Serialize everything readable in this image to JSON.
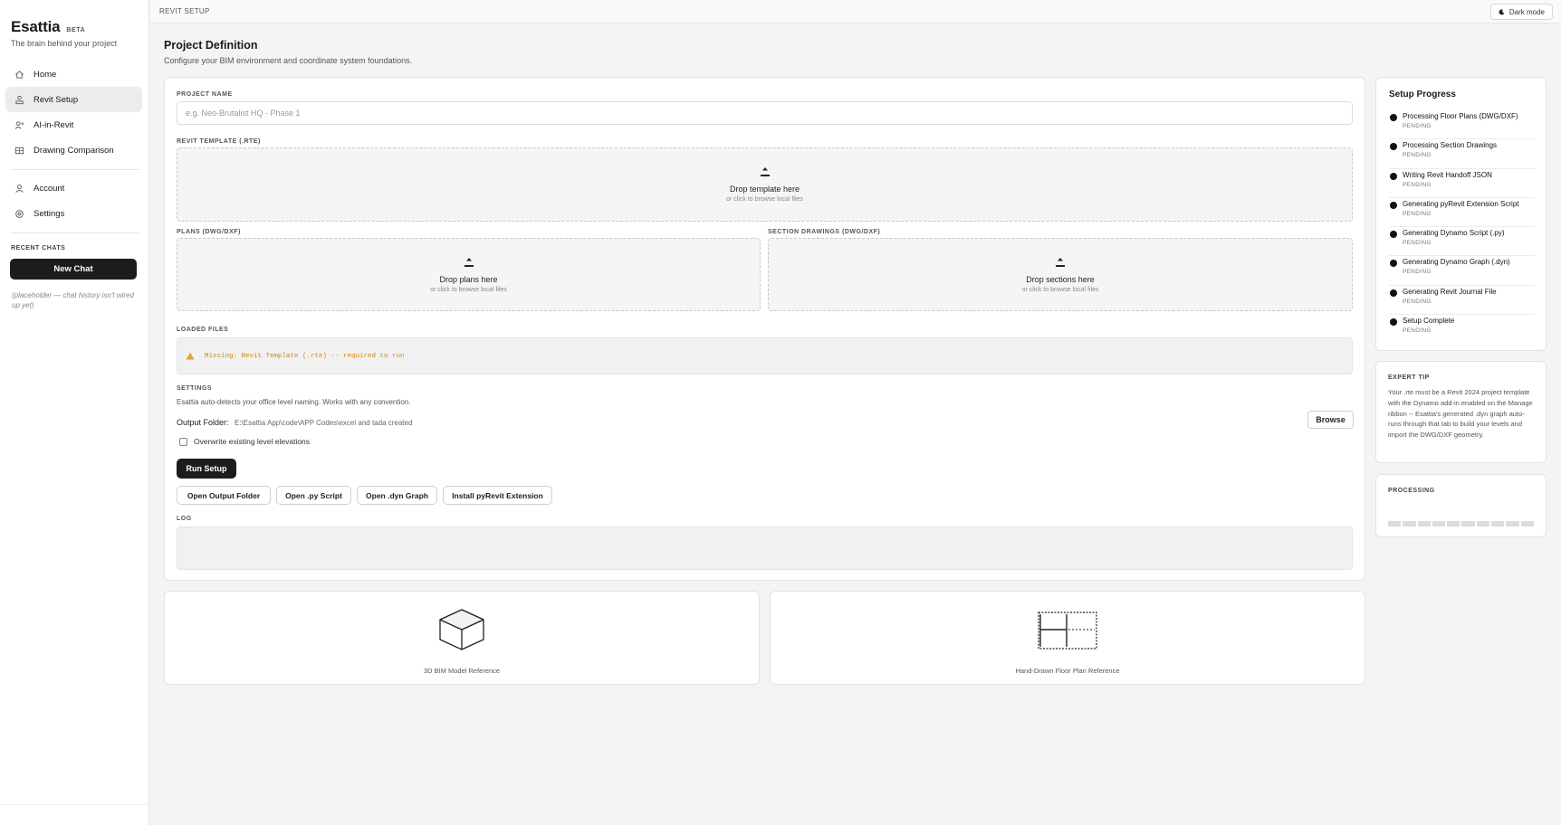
{
  "app": {
    "name": "Esattia",
    "badge": "BETA",
    "tagline": "The brain behind your project"
  },
  "nav": {
    "items": [
      {
        "label": "Home",
        "icon": "home-icon"
      },
      {
        "label": "Revit Setup",
        "icon": "revit-setup-icon",
        "active": true
      },
      {
        "label": "AI-in-Revit",
        "icon": "ai-icon"
      },
      {
        "label": "Drawing Comparison",
        "icon": "comparison-icon"
      }
    ],
    "secondary": [
      {
        "label": "Account",
        "icon": "user-icon"
      },
      {
        "label": "Settings",
        "icon": "gear-icon"
      }
    ]
  },
  "recent": {
    "title": "RECENT CHATS",
    "new_chat": "New Chat",
    "placeholder": "(placeholder — chat history isn't wired up yet)"
  },
  "topbar": {
    "breadcrumb": "REVIT SETUP",
    "dark_mode": "Dark mode"
  },
  "header": {
    "title": "Project Definition",
    "subtitle": "Configure your BIM environment and coordinate system foundations."
  },
  "form": {
    "project_name_label": "PROJECT NAME",
    "project_name_placeholder": "e.g. Neo-Brutalist HQ - Phase 1",
    "project_name_value": "",
    "template_label": "REVIT TEMPLATE (.RTE)",
    "template_drop_title": "Drop template here",
    "template_drop_sub": "or click to browse local files",
    "plans_label": "PLANS (DWG/DXF)",
    "plans_drop_title": "Drop plans here",
    "plans_drop_sub": "or click to browse local files",
    "sections_label": "SECTION DRAWINGS (DWG/DXF)",
    "sections_drop_title": "Drop sections here",
    "sections_drop_sub": "or click to browse local files",
    "loaded_label": "LOADED FILES",
    "loaded_warning": "Missing: Revit Template (.rte) -- required to run",
    "settings_label": "SETTINGS",
    "settings_desc": "Esattia auto-detects your office level naming. Works with any convention.",
    "output_label": "Output Folder:",
    "output_path": "E:\\Esattia App\\code\\APP Codes\\excel and tada created",
    "browse": "Browse",
    "overwrite_label": "Overwrite existing level elevations",
    "overwrite_checked": false,
    "run_setup": "Run Setup",
    "actions": [
      "Open Output Folder",
      "Open .py Script",
      "Open .dyn Graph",
      "Install pyRevit Extension"
    ],
    "log_label": "LOG"
  },
  "references": [
    {
      "caption": "3D BIM Model Reference",
      "icon": "cube-icon"
    },
    {
      "caption": "Hand-Drawn Floor Plan Reference",
      "icon": "floor-plan-icon"
    }
  ],
  "progress": {
    "title": "Setup Progress",
    "steps": [
      {
        "label": "Processing Floor Plans (DWG/DXF)",
        "status": "PENDING"
      },
      {
        "label": "Processing Section Drawings",
        "status": "PENDING"
      },
      {
        "label": "Writing Revit Handoff JSON",
        "status": "PENDING"
      },
      {
        "label": "Generating pyRevit Extension Script",
        "status": "PENDING"
      },
      {
        "label": "Generating Dynamo Script (.py)",
        "status": "PENDING"
      },
      {
        "label": "Generating Dynamo Graph (.dyn)",
        "status": "PENDING"
      },
      {
        "label": "Generating Revit Journal File",
        "status": "PENDING"
      },
      {
        "label": "Setup Complete",
        "status": "PENDING"
      }
    ]
  },
  "tip": {
    "title": "EXPERT TIP",
    "text": "Your .rte must be a Revit 2024 project template with the Dynamo add-in enabled on the Manage ribbon -- Esattia's generated .dyn graph auto-runs through that tab to build your levels and import the DWG/DXF geometry."
  },
  "processing": {
    "title": "PROCESSING",
    "progress": 0
  },
  "colors": {
    "accent": "#1c1c1c",
    "warning": "#c98a1a",
    "background": "#f4f4f4"
  }
}
